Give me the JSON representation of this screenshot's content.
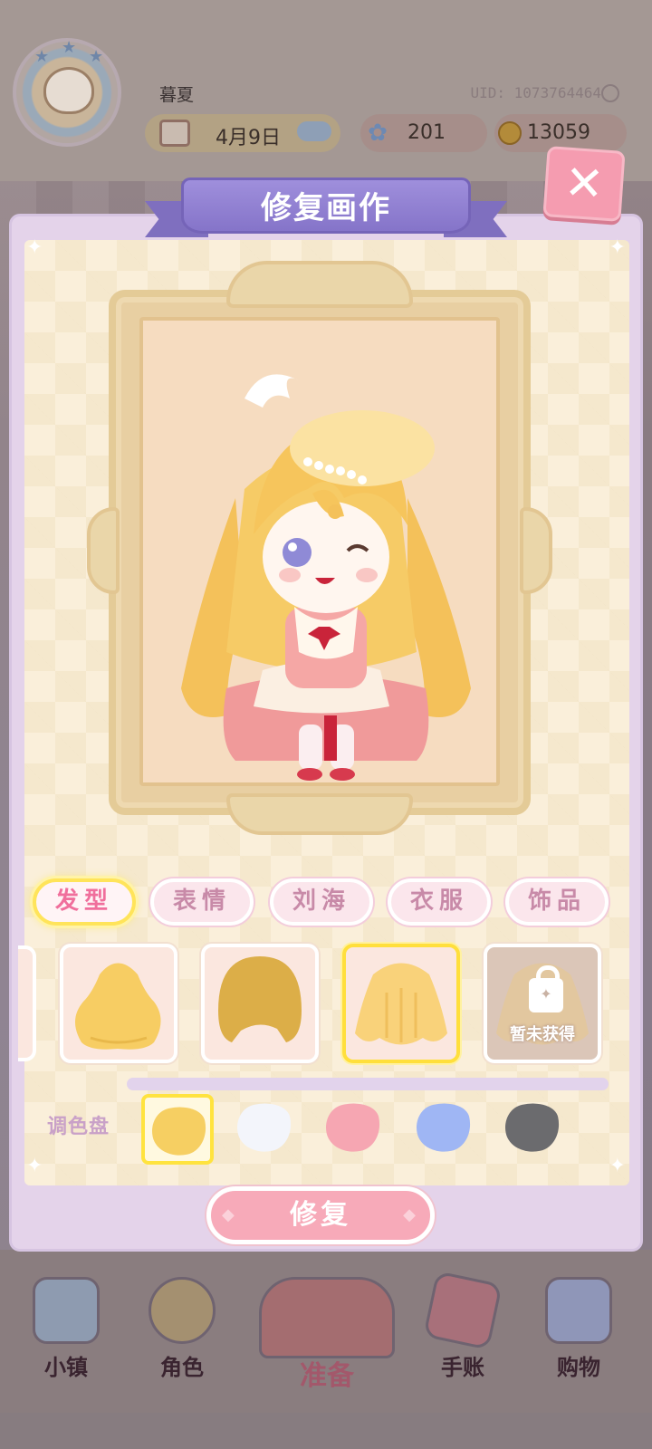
{
  "hud": {
    "player_name": "暮夏",
    "uid_text": "UID: 1073764464",
    "date": "4月9日",
    "gems": "201",
    "coins": "13059"
  },
  "modal": {
    "title": "修复画作",
    "close_symbol": "✕",
    "tabs": [
      {
        "label": "发型",
        "active": true
      },
      {
        "label": "表情",
        "active": false
      },
      {
        "label": "刘海",
        "active": false
      },
      {
        "label": "衣服",
        "active": false
      },
      {
        "label": "饰品",
        "active": false
      }
    ],
    "items": [
      {
        "name": "hair-bun-short",
        "selected": false,
        "locked": false
      },
      {
        "name": "hair-bob",
        "selected": false,
        "locked": false
      },
      {
        "name": "hair-long-wavy",
        "selected": true,
        "locked": false
      },
      {
        "name": "hair-locked",
        "selected": false,
        "locked": true,
        "locked_label": "暂未获得"
      }
    ],
    "palette_label": "调色盘",
    "palette": [
      {
        "color": "#f6cf62",
        "selected": true
      },
      {
        "color": "#f3f5fb",
        "selected": false
      },
      {
        "color": "#f6a6b2",
        "selected": false
      },
      {
        "color": "#9fb6f4",
        "selected": false
      },
      {
        "color": "#6b6b6e",
        "selected": false
      }
    ],
    "repair_label": "修复"
  },
  "bottom_nav": [
    {
      "label": "小镇",
      "icon": "map-icon"
    },
    {
      "label": "角色",
      "icon": "character-icon"
    },
    {
      "label": "准备",
      "icon": "dress-icon"
    },
    {
      "label": "手账",
      "icon": "journal-icon"
    },
    {
      "label": "购物",
      "icon": "shopping-bag-icon"
    }
  ],
  "colors": {
    "modal_bg": "#e4d3ea",
    "ribbon": "#8574c9",
    "accent_pink": "#f06f9c",
    "highlight_yellow": "#ffe45a",
    "button_pink": "#f7aab9"
  }
}
